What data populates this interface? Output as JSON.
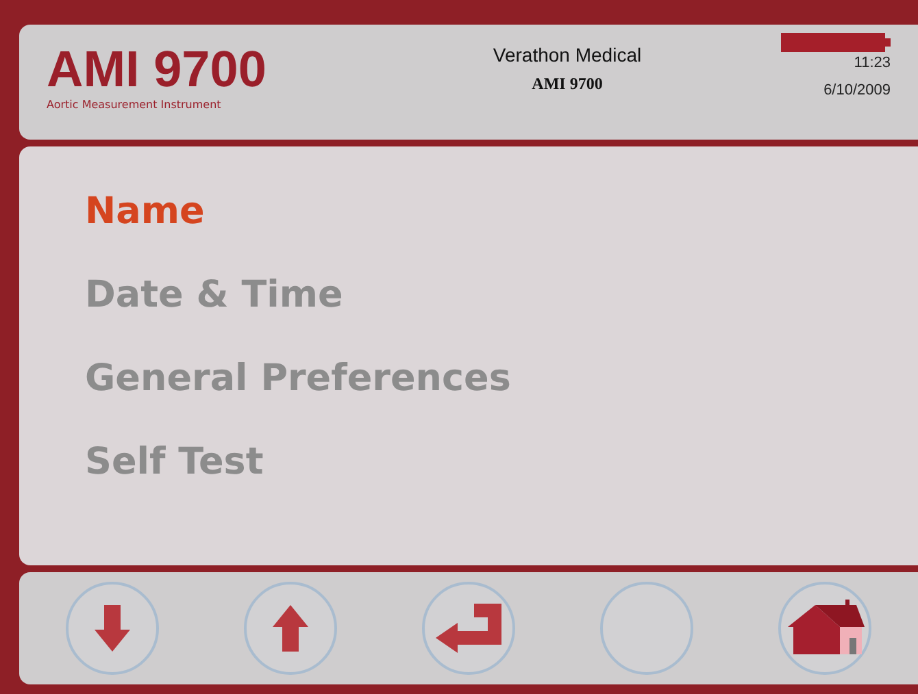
{
  "header": {
    "logo_title": "AMI 9700",
    "logo_subtitle": "Aortic Measurement Instrument",
    "company": "Verathon Medical",
    "model": "AMI 9700",
    "time": "11:23",
    "date": "6/10/2009"
  },
  "menu": [
    {
      "label": "Name",
      "selected": true
    },
    {
      "label": "Date & Time",
      "selected": false
    },
    {
      "label": "General Preferences",
      "selected": false
    },
    {
      "label": "Self Test",
      "selected": false
    }
  ],
  "buttons": [
    {
      "kind": "down"
    },
    {
      "kind": "up"
    },
    {
      "kind": "enter"
    },
    {
      "kind": "blank"
    },
    {
      "kind": "home"
    }
  ]
}
